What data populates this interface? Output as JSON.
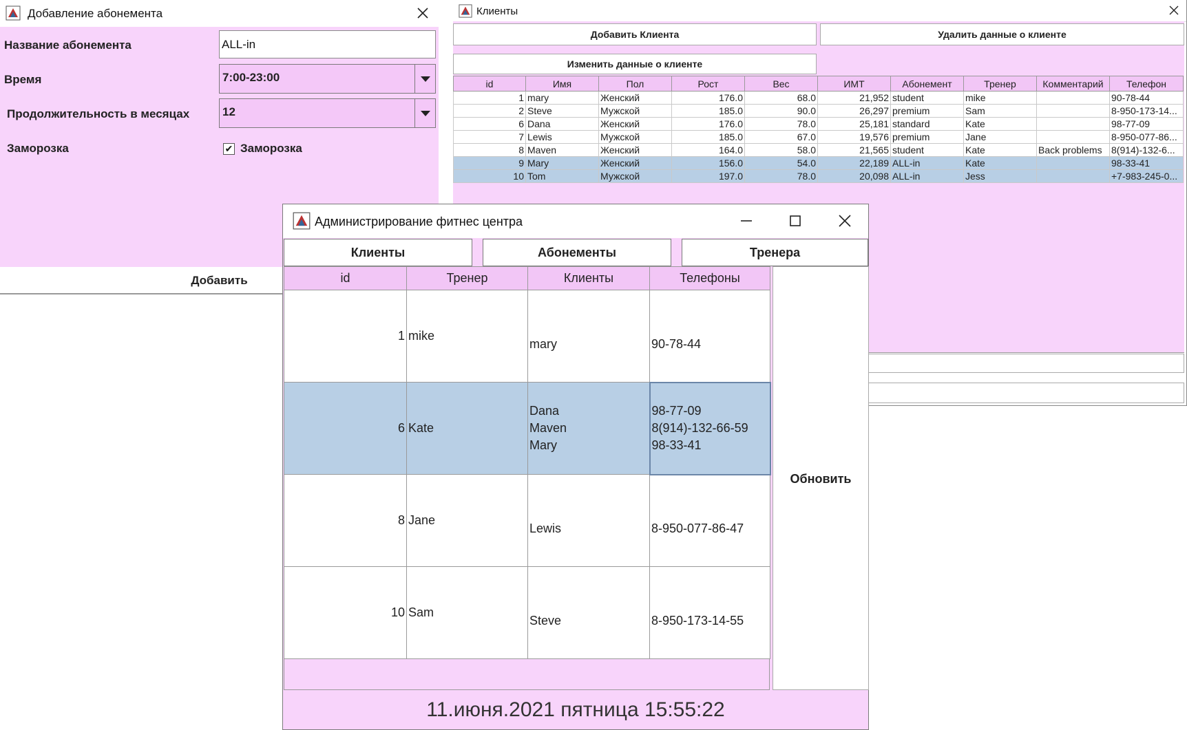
{
  "add_subscription": {
    "title": "Добавление абонемента",
    "name_label": "Название абонемента",
    "name_value": "ALL-in",
    "time_label": "Время",
    "time_value": "7:00-23:00",
    "duration_label": "Продолжительность в месяцах",
    "duration_value": "12",
    "freeze_label": "Заморозка",
    "freeze_checkbox_label": "Заморозка",
    "freeze_checked": true,
    "add_button": "Добавить"
  },
  "clients": {
    "title": "Клиенты",
    "add_button": "Добавить Клиента",
    "delete_button": "Удалить данные о клиенте",
    "edit_button": "Изменить данные о клиенте",
    "columns": [
      "id",
      "Имя",
      "Пол",
      "Рост",
      "Вес",
      "ИМТ",
      "Абонемент",
      "Тренер",
      "Комментарий",
      "Телефон"
    ],
    "rows": [
      {
        "id": "1",
        "name": "mary",
        "sex": "Женский",
        "height": "176.0",
        "weight": "68.0",
        "bmi": "21,952",
        "sub": "student",
        "trainer": "mike",
        "comment": "",
        "phone": "90-78-44"
      },
      {
        "id": "2",
        "name": "Steve",
        "sex": "Мужской",
        "height": "185.0",
        "weight": "90.0",
        "bmi": "26,297",
        "sub": "premium",
        "trainer": "Sam",
        "comment": "",
        "phone": "8-950-173-14..."
      },
      {
        "id": "6",
        "name": "Dana",
        "sex": "Женский",
        "height": "176.0",
        "weight": "78.0",
        "bmi": "25,181",
        "sub": "standard",
        "trainer": "Kate",
        "comment": "",
        "phone": "98-77-09"
      },
      {
        "id": "7",
        "name": "Lewis",
        "sex": "Мужской",
        "height": "185.0",
        "weight": "67.0",
        "bmi": "19,576",
        "sub": "premium",
        "trainer": "Jane",
        "comment": "",
        "phone": "8-950-077-86..."
      },
      {
        "id": "8",
        "name": "Maven",
        "sex": "Женский",
        "height": "164.0",
        "weight": "58.0",
        "bmi": "21,565",
        "sub": "student",
        "trainer": "Kate",
        "comment": "Back problems",
        "phone": "8(914)-132-6..."
      },
      {
        "id": "9",
        "name": "Mary",
        "sex": "Женский",
        "height": "156.0",
        "weight": "54.0",
        "bmi": "22,189",
        "sub": "ALL-in",
        "trainer": "Kate",
        "comment": "",
        "phone": "98-33-41"
      },
      {
        "id": "10",
        "name": "Tom",
        "sex": "Мужской",
        "height": "197.0",
        "weight": "78.0",
        "bmi": "20,098",
        "sub": "ALL-in",
        "trainer": "Jess",
        "comment": "",
        "phone": "+7-983-245-0..."
      }
    ]
  },
  "admin": {
    "title": "Администрирование фитнес центра",
    "tabs": [
      "Клиенты",
      "Абонементы",
      "Тренера"
    ],
    "columns": [
      "id",
      "Тренер",
      "Клиенты",
      "Телефоны"
    ],
    "rows": [
      {
        "id": "1",
        "trainer": "mike",
        "clients": [
          "mary"
        ],
        "phones": [
          "90-78-44"
        ]
      },
      {
        "id": "6",
        "trainer": "Kate",
        "clients": [
          "Dana",
          "Maven",
          "Mary"
        ],
        "phones": [
          "98-77-09",
          "8(914)-132-66-59",
          "98-33-41"
        ]
      },
      {
        "id": "8",
        "trainer": "Jane",
        "clients": [
          "Lewis"
        ],
        "phones": [
          "8-950-077-86-47"
        ]
      },
      {
        "id": "10",
        "trainer": "Sam",
        "clients": [
          "Steve"
        ],
        "phones": [
          "8-950-173-14-55"
        ]
      }
    ],
    "refresh_button": "Обновить",
    "datetime": "11.июня.2021 пятница 15:55:22"
  },
  "colors": {
    "background": "#f8d4fb",
    "header": "#f2c6f6",
    "selection": "#b8cfe5"
  },
  "icons": [
    "app-icon",
    "close-icon",
    "minimize-icon",
    "maximize-icon",
    "chevron-down-icon",
    "checkmark-icon"
  ]
}
